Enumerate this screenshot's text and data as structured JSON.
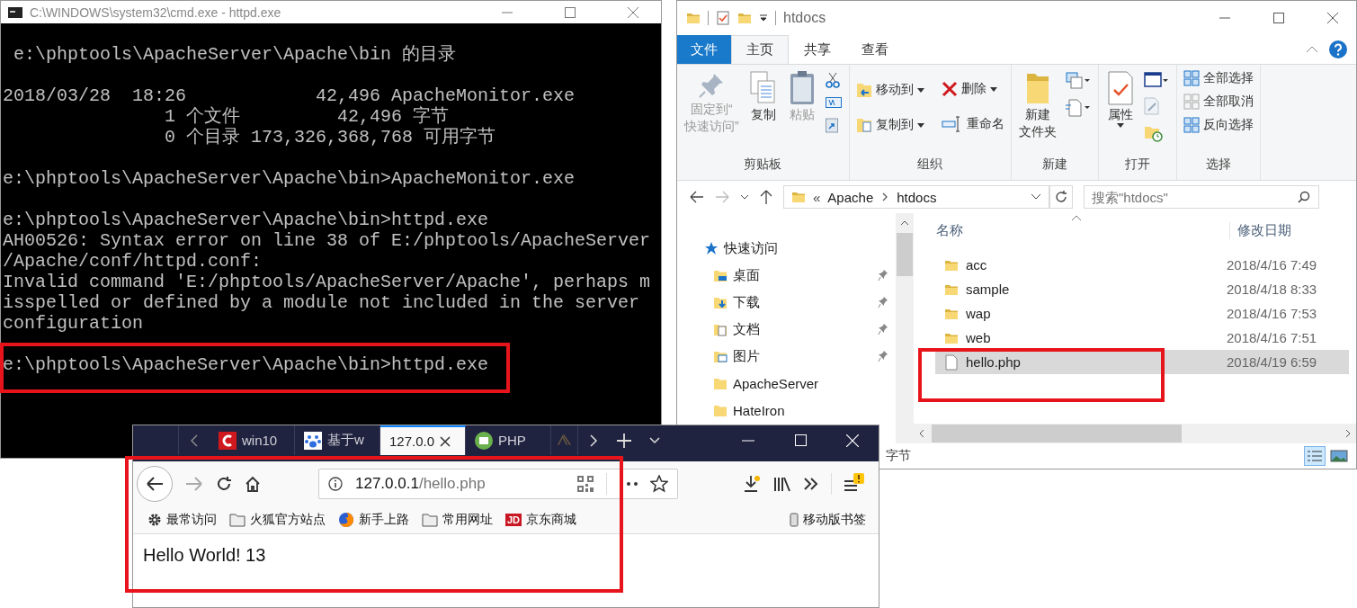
{
  "cmd": {
    "title": "C:\\WINDOWS\\system32\\cmd.exe - httpd.exe",
    "blocks": [
      [
        " e:\\phptools\\ApacheServer\\Apache\\bin 的目录"
      ],
      [
        "2018/03/28  18:26            42,496 ApacheMonitor.exe",
        "               1 个文件         42,496 字节",
        "               0 个目录 173,326,368,768 可用字节"
      ],
      [
        "e:\\phptools\\ApacheServer\\Apache\\bin>ApacheMonitor.exe"
      ],
      [
        "e:\\phptools\\ApacheServer\\Apache\\bin>httpd.exe",
        "AH00526: Syntax error on line 38 of E:/phptools/ApacheServer",
        "/Apache/conf/httpd.conf:",
        "Invalid command 'E:/phptools/ApacheServer/Apache', perhaps m",
        "isspelled or defined by a module not included in the server",
        "configuration"
      ],
      [
        "e:\\phptools\\ApacheServer\\Apache\\bin>httpd.exe"
      ]
    ]
  },
  "explorer": {
    "title": "htdocs",
    "tabs": [
      {
        "label": "文件",
        "kind": "file",
        "selected": false
      },
      {
        "label": "主页",
        "kind": "tab",
        "selected": true
      },
      {
        "label": "共享",
        "kind": "tab",
        "selected": false
      },
      {
        "label": "查看",
        "kind": "tab",
        "selected": false
      }
    ],
    "groups": [
      {
        "label": "剪贴板",
        "items": [
          {
            "kind": "large",
            "lines": [
              "固定到“",
              "快速访问”"
            ],
            "disabled": true,
            "dropdown": false
          },
          {
            "kind": "large",
            "lines": [
              "复制"
            ],
            "disabled": false,
            "dropdown": false
          },
          {
            "kind": "large",
            "lines": [
              "粘贴"
            ],
            "disabled": true,
            "dropdown": false
          }
        ]
      },
      {
        "label": "组织",
        "items": [
          {
            "kind": "small",
            "lines": [
              "移动到"
            ],
            "disabled": false,
            "dropdown": true
          },
          {
            "kind": "small",
            "lines": [
              "复制到"
            ],
            "disabled": false,
            "dropdown": true
          },
          {
            "kind": "small",
            "lines": [
              "删除"
            ],
            "disabled": false,
            "dropdown": true
          },
          {
            "kind": "small",
            "lines": [
              "重命名"
            ],
            "disabled": false,
            "dropdown": false
          }
        ]
      },
      {
        "label": "新建",
        "items": [
          {
            "kind": "large",
            "lines": [
              "新建",
              "文件夹"
            ],
            "disabled": false,
            "dropdown": false
          }
        ]
      },
      {
        "label": "打开",
        "items": [
          {
            "kind": "large",
            "lines": [
              "属性"
            ],
            "disabled": false,
            "dropdown": true
          }
        ]
      },
      {
        "label": "选择",
        "items": [
          {
            "kind": "small",
            "lines": [
              "全部选择"
            ],
            "disabled": false,
            "dropdown": false
          },
          {
            "kind": "small",
            "lines": [
              "全部取消"
            ],
            "disabled": false,
            "dropdown": false
          },
          {
            "kind": "small",
            "lines": [
              "反向选择"
            ],
            "disabled": false,
            "dropdown": false
          }
        ]
      }
    ],
    "path_prefix": "«",
    "path": [
      "Apache",
      "htdocs"
    ],
    "search": {
      "placeholder": "搜索\"htdocs\""
    },
    "nav": [
      {
        "label": "快速访问",
        "children": [
          {
            "label": "桌面",
            "kind": "desktop",
            "pinned": true
          },
          {
            "label": "下载",
            "kind": "download",
            "pinned": true
          },
          {
            "label": "文档",
            "kind": "docs",
            "pinned": true
          },
          {
            "label": "图片",
            "kind": "pictures",
            "pinned": true
          },
          {
            "label": "ApacheServer",
            "kind": "folder",
            "pinned": false
          },
          {
            "label": "HateIron",
            "kind": "folder",
            "pinned": false
          }
        ]
      }
    ],
    "columns": [
      "名称",
      "修改日期"
    ],
    "rows": [
      {
        "name": "acc",
        "date": "2018/4/16 7:49",
        "kind": "folder",
        "selected": false
      },
      {
        "name": "sample",
        "date": "2018/4/18 8:33",
        "kind": "folder",
        "selected": false
      },
      {
        "name": "wap",
        "date": "2018/4/16 7:53",
        "kind": "folder",
        "selected": false
      },
      {
        "name": "web",
        "date": "2018/4/16 7:51",
        "kind": "folder",
        "selected": false
      },
      {
        "name": "hello.php",
        "date": "2018/4/19 6:59",
        "kind": "file",
        "selected": true
      }
    ],
    "status": "字节"
  },
  "firefox": {
    "tabs": [
      {
        "label": "win10",
        "kind": "c",
        "selected": false
      },
      {
        "label": "基于w",
        "kind": "paw",
        "selected": false
      },
      {
        "label": "127.0.0",
        "kind": "none",
        "selected": true
      },
      {
        "label": "PHP",
        "kind": "code",
        "selected": false
      },
      {
        "kind": "faded",
        "selected": false
      }
    ],
    "url": {
      "host": "127.0.0.1",
      "path": "/hello.php"
    },
    "bookmarks": [
      {
        "label": "最常访问",
        "kind": "gear"
      },
      {
        "label": "火狐官方站点",
        "kind": "folder"
      },
      {
        "label": "新手上路",
        "kind": "globe"
      },
      {
        "label": "常用网址",
        "kind": "folder"
      },
      {
        "label": "京东商城",
        "kind": "logo",
        "badge": "JD"
      }
    ],
    "mobile_bookmarks": "移动版书签",
    "content": "Hello World! 13"
  }
}
